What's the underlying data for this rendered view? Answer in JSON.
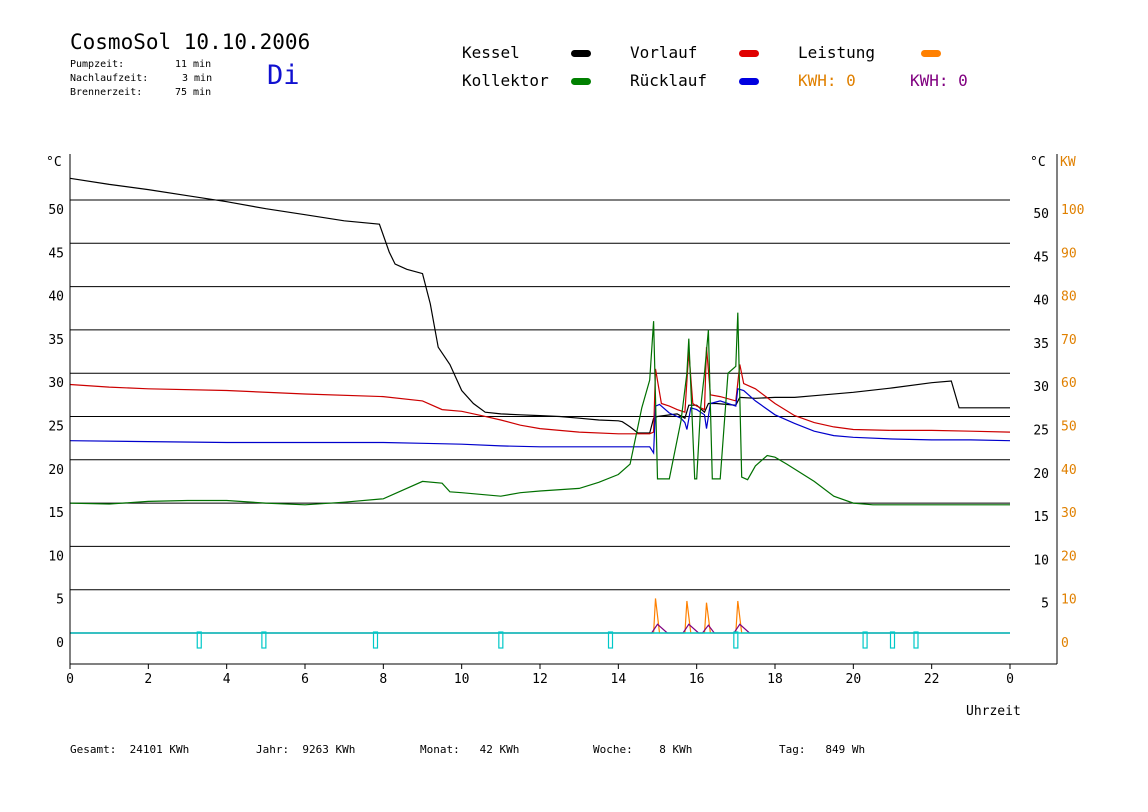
{
  "header": {
    "title": "CosmoSol 10.10.2006",
    "weekday": "Di",
    "pump_label": "Pumpzeit:",
    "pump_value": "11 min",
    "nach_label": "Nachlaufzeit:",
    "nach_value": "3 min",
    "brenner_label": "Brennerzeit:",
    "brenner_value": "75 min"
  },
  "legend": {
    "kessel": {
      "label": "Kessel",
      "color": "#000000"
    },
    "vorlauf": {
      "label": "Vorlauf",
      "color": "#e00000"
    },
    "leistung": {
      "label": "Leistung",
      "color": "#ff8000"
    },
    "kollektor": {
      "label": "Kollektor",
      "color": "#008000"
    },
    "ruecklauf": {
      "label": "Rücklauf",
      "color": "#0000e0"
    },
    "kwh1": {
      "label": "KWH: 0",
      "color": "#e08000"
    },
    "kwh2": {
      "label": "KWH: 0",
      "color": "#800080"
    }
  },
  "footer": {
    "gesamt": "Gesamt:  24101 KWh",
    "jahr": "Jahr:  9263 KWh",
    "monat": "Monat:   42 KWh",
    "woche": "Woche:    8 KWh",
    "tag": "Tag:   849 Wh"
  },
  "chart_data": {
    "type": "line",
    "xlabel": "Uhrzeit",
    "x_ticks": [
      "0",
      "2",
      "4",
      "6",
      "8",
      "10",
      "12",
      "14",
      "16",
      "18",
      "20",
      "22",
      "0"
    ],
    "xlim": [
      0,
      24
    ],
    "y_unit_left": "°C",
    "y_unit_right": "°C",
    "y2_unit": "KW",
    "ylim": [
      -3.5,
      57
    ],
    "y_ticks": [
      0,
      5,
      10,
      15,
      20,
      25,
      30,
      35,
      40,
      45,
      50
    ],
    "y_ticks_left": [
      "0",
      "5",
      "10",
      "15",
      "20",
      "25",
      "30",
      "35",
      "40",
      "45",
      "50"
    ],
    "y_ticks_right": [
      "5",
      "10",
      "15",
      "20",
      "25",
      "30",
      "35",
      "40",
      "45",
      "50"
    ],
    "y2_ticks": [
      "0",
      "10",
      "20",
      "30",
      "40",
      "50",
      "60",
      "70",
      "80",
      "90",
      "100"
    ],
    "grid": "horizontal",
    "series": [
      {
        "name": "Kessel",
        "color": "#000000",
        "x": [
          0,
          1,
          2,
          3,
          4,
          5,
          6,
          7,
          7.9,
          8.15,
          8.3,
          8.6,
          9.0,
          9.2,
          9.4,
          9.7,
          10.0,
          10.3,
          10.6,
          11.0,
          11.5,
          12.0,
          12.5,
          13.0,
          13.5,
          14.0,
          14.1,
          14.2,
          14.3,
          14.5,
          14.8,
          14.9,
          15.0,
          15.5,
          15.7,
          15.8,
          16.0,
          16.2,
          16.3,
          16.5,
          17.0,
          17.1,
          17.5,
          18.0,
          18.5,
          19,
          20,
          21,
          22,
          22.5,
          22.7,
          23,
          24
        ],
        "y": [
          52.5,
          51.8,
          51.2,
          50.5,
          49.8,
          49,
          48.3,
          47.6,
          47.2,
          44,
          42.6,
          42,
          41.5,
          38,
          33,
          31,
          28,
          26.5,
          25.5,
          25.3,
          25.2,
          25.1,
          25,
          24.8,
          24.6,
          24.5,
          24.4,
          24.1,
          23.8,
          23.1,
          23.1,
          24.8,
          25,
          25.3,
          24.8,
          26.3,
          26.3,
          25.5,
          26.5,
          26.5,
          26.3,
          27.2,
          27.1,
          27.2,
          27.2,
          27.4,
          27.8,
          28.3,
          28.9,
          29.1,
          26,
          26,
          26
        ]
      },
      {
        "name": "Vorlauf",
        "color": "#cc0000",
        "x": [
          0,
          1,
          2,
          4,
          6,
          8,
          9,
          9.5,
          10,
          10.5,
          11,
          11.5,
          12,
          13,
          14,
          14.5,
          14.8,
          14.9,
          14.95,
          15.1,
          15.3,
          15.5,
          15.7,
          15.8,
          15.9,
          16.0,
          16.2,
          16.25,
          16.35,
          16.6,
          17.0,
          17.1,
          17.2,
          17.5,
          18,
          18.5,
          19,
          19.5,
          20,
          21,
          22,
          23,
          24
        ],
        "y": [
          28.7,
          28.4,
          28.2,
          28,
          27.6,
          27.3,
          26.8,
          25.8,
          25.6,
          25.1,
          24.6,
          24,
          23.6,
          23.2,
          23,
          23,
          23,
          23.2,
          30.5,
          26.5,
          26.2,
          25.8,
          25.5,
          32.5,
          26.5,
          26.2,
          25.8,
          33,
          27.5,
          27.3,
          26.8,
          31,
          28.8,
          28.2,
          26.5,
          25.1,
          24.3,
          23.8,
          23.5,
          23.4,
          23.4,
          23.3,
          23.2
        ]
      },
      {
        "name": "Rücklauf",
        "color": "#0000cc",
        "x": [
          0,
          2,
          4,
          6,
          8,
          9,
          10,
          11,
          12,
          13,
          14,
          14.8,
          14.9,
          14.95,
          15.05,
          15.3,
          15.6,
          15.7,
          15.75,
          15.85,
          16.0,
          16.2,
          16.25,
          16.35,
          16.6,
          17.0,
          17.05,
          17.2,
          17.5,
          18,
          18.5,
          19,
          19.5,
          20,
          21,
          22,
          23,
          24
        ],
        "y": [
          22.2,
          22.1,
          22,
          22,
          22,
          21.9,
          21.8,
          21.6,
          21.5,
          21.5,
          21.5,
          21.5,
          20.8,
          26.2,
          26.4,
          25.4,
          24.8,
          24.3,
          23.5,
          26,
          25.8,
          25.2,
          23.6,
          26.5,
          26.8,
          26.2,
          28.2,
          28,
          26.8,
          25.2,
          24.2,
          23.3,
          22.8,
          22.6,
          22.4,
          22.3,
          22.3,
          22.2
        ]
      },
      {
        "name": "Kollektor",
        "color": "#007000",
        "x": [
          0,
          1,
          2,
          3,
          4,
          5,
          6,
          7,
          8,
          9,
          9.5,
          9.7,
          10,
          11,
          11.5,
          12,
          13,
          13.5,
          14,
          14.3,
          14.6,
          14.8,
          14.9,
          15.0,
          15.3,
          15.6,
          15.75,
          15.8,
          15.95,
          16.0,
          16.1,
          16.2,
          16.3,
          16.4,
          16.6,
          16.8,
          17.0,
          17.05,
          17.15,
          17.3,
          17.5,
          17.8,
          18,
          18.3,
          19,
          19.5,
          20,
          20.5,
          21,
          22,
          23,
          24
        ],
        "y": [
          15,
          14.9,
          15.2,
          15.3,
          15.3,
          15,
          14.8,
          15.1,
          15.5,
          17.5,
          17.3,
          16.3,
          16.2,
          15.8,
          16.2,
          16.4,
          16.7,
          17.4,
          18.3,
          19.5,
          26,
          29.2,
          36,
          17.8,
          17.8,
          24.5,
          30,
          34,
          17.8,
          17.8,
          26,
          30,
          35,
          17.8,
          17.8,
          30,
          30.8,
          37,
          18,
          17.7,
          19.3,
          20.5,
          20.3,
          19.5,
          17.5,
          15.8,
          15,
          14.8,
          14.8,
          14.8,
          14.8,
          14.8
        ]
      },
      {
        "name": "Leistung",
        "color": "#ff8000",
        "x": [
          0,
          14.8,
          14.9,
          14.95,
          15.05,
          15.6,
          15.7,
          15.75,
          15.85,
          16.1,
          16.2,
          16.25,
          16.35,
          16.9,
          17.0,
          17.05,
          17.15,
          24
        ],
        "y": [
          0,
          0,
          0,
          4,
          0,
          0,
          0,
          3.7,
          0,
          0,
          0,
          3.5,
          0,
          0,
          0,
          3.7,
          0,
          0
        ]
      },
      {
        "name": "Leistung KWH",
        "color": "#800080",
        "x": [
          0,
          14.85,
          15.0,
          15.25,
          15.3,
          15.65,
          15.8,
          16.05,
          16.1,
          16.15,
          16.3,
          16.45,
          16.5,
          16.95,
          17.1,
          17.35,
          17.4,
          24
        ],
        "y": [
          0,
          0,
          1,
          0,
          0,
          0,
          1,
          0,
          0,
          0,
          0.9,
          0,
          0,
          0,
          1,
          0,
          0,
          0
        ]
      },
      {
        "name": "Pumpe",
        "color": "#00c8c8",
        "x": [
          0,
          24
        ],
        "y": [
          0,
          0
        ]
      }
    ],
    "pump_marks_x": [
      3.3,
      4.95,
      7.8,
      11.0,
      13.8,
      17.0,
      20.3,
      21.0,
      21.6
    ]
  }
}
